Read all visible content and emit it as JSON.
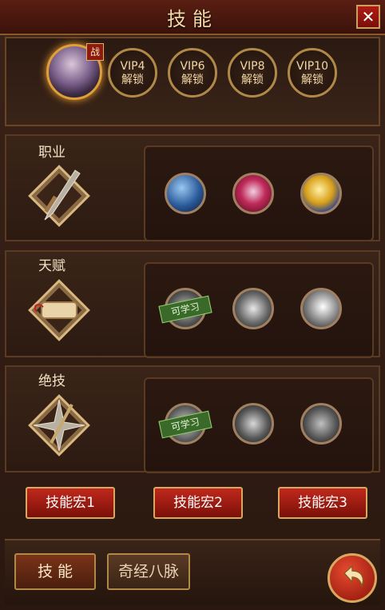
{
  "window": {
    "title": "技能",
    "close_label": "✕"
  },
  "hero": {
    "badge": "战"
  },
  "vip_slots": [
    {
      "level": "VIP4",
      "status": "解锁"
    },
    {
      "level": "VIP6",
      "status": "解锁"
    },
    {
      "level": "VIP8",
      "status": "解锁"
    },
    {
      "level": "VIP10",
      "status": "解锁"
    }
  ],
  "sections": [
    {
      "label": "职业"
    },
    {
      "label": "天赋",
      "learnable_tag": "可学习"
    },
    {
      "label": "绝技",
      "learnable_tag": "可学习"
    }
  ],
  "macros": [
    "技能宏1",
    "技能宏2",
    "技能宏3"
  ],
  "tabs": {
    "active": "技 能",
    "inactive": "奇经八脉"
  },
  "colors": {
    "accent_gold": "#d8a860",
    "button_red": "#c0281c",
    "learn_green": "#3a6a2a"
  }
}
